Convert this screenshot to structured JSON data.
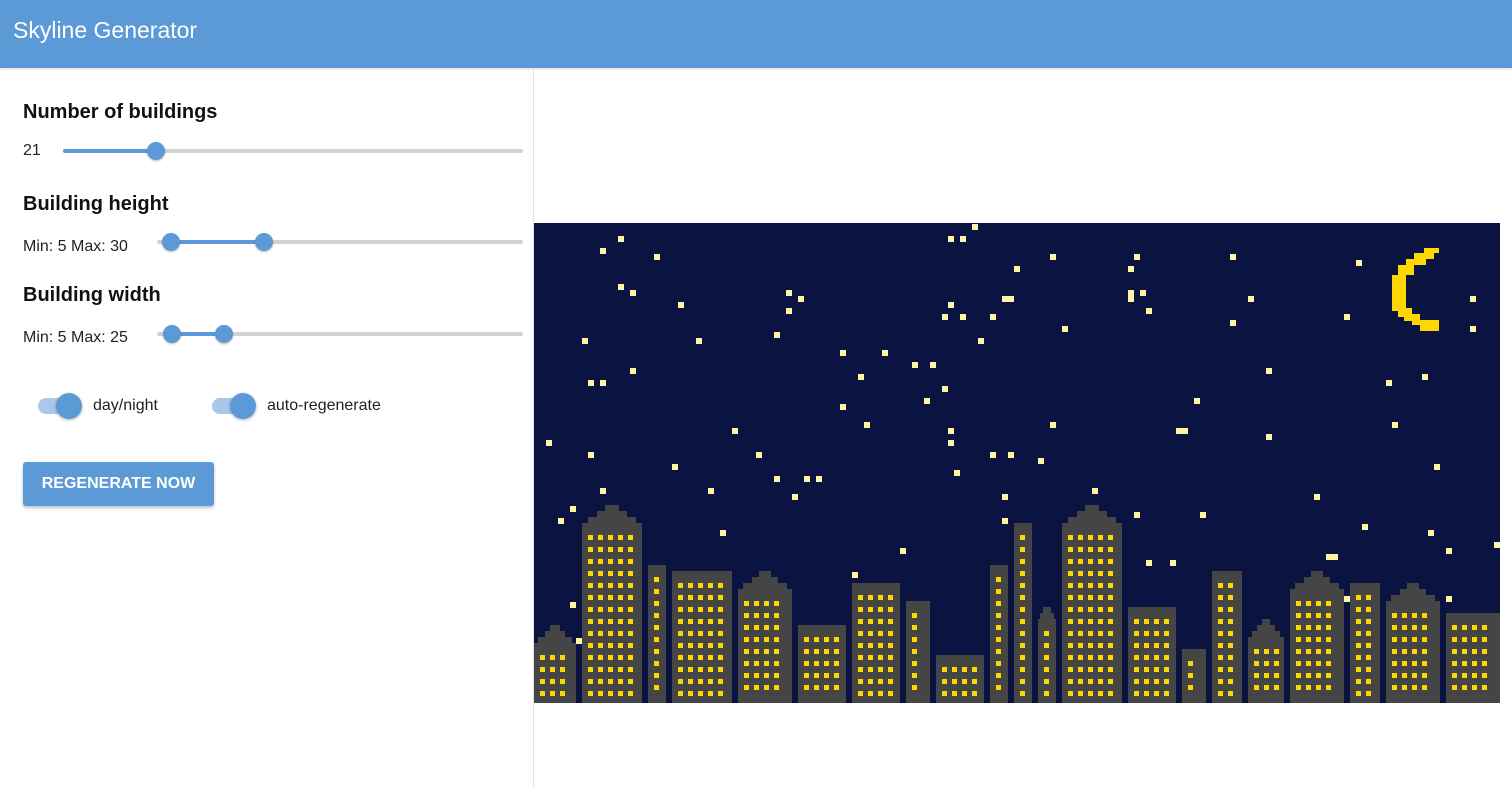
{
  "appbar": {
    "title": "Skyline Generator"
  },
  "controls": {
    "buildings": {
      "title": "Number of buildings",
      "value_label": "21",
      "value": 21,
      "min": 1,
      "max": 100
    },
    "height": {
      "title": "Building height",
      "range_label": "Min: 5 Max: 30",
      "min_value": 5,
      "max_value": 30,
      "range_min": 1,
      "range_max": 100
    },
    "width": {
      "title": "Building width",
      "range_label": "Min: 5 Max: 25",
      "min_value": 5,
      "max_value": 25,
      "range_min": 1,
      "range_max": 100
    }
  },
  "toggles": {
    "day_night": {
      "label": "day/night",
      "on": true
    },
    "auto_regenerate": {
      "label": "auto-regenerate",
      "on": true
    }
  },
  "actions": {
    "regenerate_label": "REGENERATE NOW"
  },
  "colors": {
    "accent": "#5b9ad6",
    "sky": "#0b1340",
    "star": "#fff3a6",
    "moon": "#ffd700",
    "building": "#454545",
    "window": "#ffd700"
  }
}
